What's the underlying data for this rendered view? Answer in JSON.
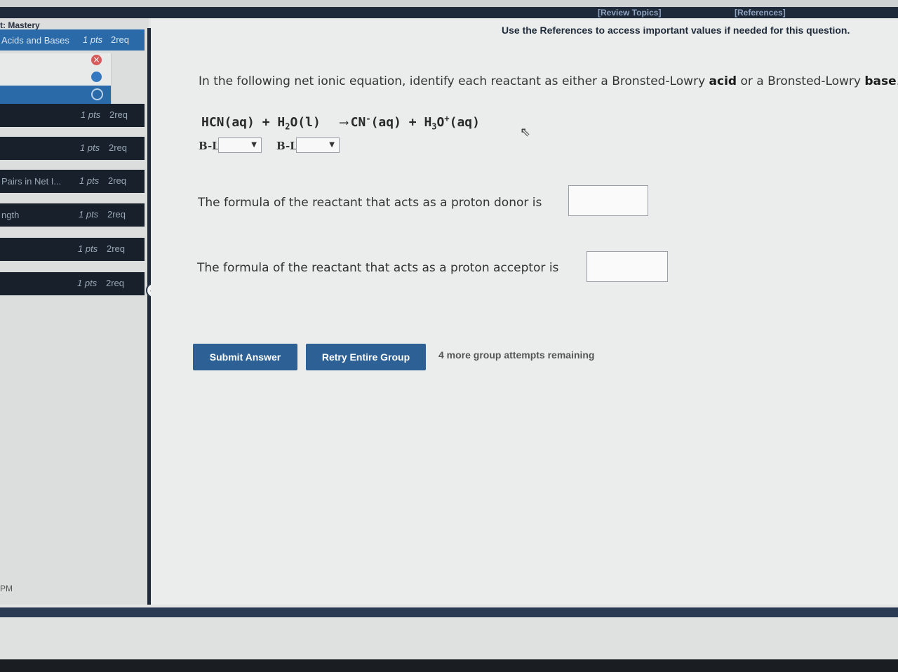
{
  "header": {
    "review_topics": "[Review Topics]",
    "references": "[References]"
  },
  "sidebar": {
    "title": "t: Mastery",
    "items": [
      {
        "name": "Acids and Bases",
        "pts": "1 pts",
        "req": "2req"
      },
      {
        "name": "",
        "pts": "1 pts",
        "req": "2req"
      },
      {
        "name": "",
        "pts": "1 pts",
        "req": "2req"
      },
      {
        "name": "Pairs in Net I...",
        "pts": "1 pts",
        "req": "2req"
      },
      {
        "name": "ngth",
        "pts": "1 pts",
        "req": "2req"
      },
      {
        "name": "",
        "pts": "1 pts",
        "req": "2req"
      },
      {
        "name": "",
        "pts": "1 pts",
        "req": "2req"
      }
    ],
    "footer_time": "PM",
    "collapse_icon": "chevron-left-icon"
  },
  "question": {
    "reference_note": "Use the References to access important values if needed for this question.",
    "prompt_pre": "In the following net ionic equation, identify each reactant as either a Bronsted-Lowry ",
    "prompt_acid": "acid",
    "prompt_mid": " or a Bronsted-Lowry ",
    "prompt_base": "base",
    "prompt_end": ".",
    "equation": {
      "r1": "HCN(aq)",
      "plus1": " + ",
      "r2_a": "H",
      "r2_sub": "2",
      "r2_b": "O(l)",
      "p1_a": "CN",
      "p1_sup": "-",
      "p1_b": "(aq)",
      "plus2": " + ",
      "p2_a": "H",
      "p2_sub": "3",
      "p2_b": "O",
      "p2_sup": "+",
      "p2_c": "(aq)"
    },
    "bl_label_1": "B-L",
    "bl_label_2": "B-L",
    "select_1_value": "",
    "select_2_value": "",
    "donor_text": "The formula of the reactant that acts as a proton donor is",
    "acceptor_text": "The formula of the reactant that acts as a proton acceptor is",
    "donor_value": "",
    "acceptor_value": ""
  },
  "actions": {
    "submit": "Submit Answer",
    "retry": "Retry Entire Group",
    "attempts": "4 more group attempts remaining"
  }
}
